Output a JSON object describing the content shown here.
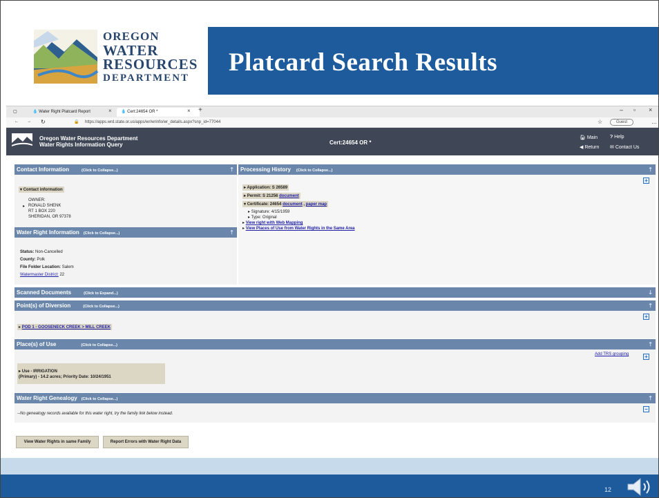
{
  "slide": {
    "title": "Platcard Search Results",
    "logo": {
      "line1": "OREGON",
      "line2": "WATER",
      "line3": "RESOURCES",
      "line4": "DEPARTMENT"
    },
    "page_number": "12",
    "colors": {
      "band": "#1d5b9d",
      "panel_header": "#6a87ab",
      "app_header": "#3f4756"
    }
  },
  "browser": {
    "tab1": "Water Right Platcard Report",
    "tab2": "Cert:24654 OR *",
    "new_tab": "+",
    "url": "https://apps.wrd.state.or.us/apps/wr/wrinfo/wr_details.aspx?snp_id=77044",
    "profile": "Guest",
    "icons": [
      "back-icon",
      "forward-icon",
      "refresh-icon",
      "lock-icon",
      "star-icon",
      "menu-icon"
    ]
  },
  "app": {
    "title_line1": "Oregon Water Resources Department",
    "title_line2": "Water Rights Information Query",
    "cert_title": "Cert:24654 OR *",
    "nav": {
      "main": "Main",
      "help": "Help",
      "return": "Return",
      "contact": "Contact Us"
    }
  },
  "contact": {
    "header": "Contact Information",
    "toggle": "(Click to Collapse...)",
    "subheader": "Contact information",
    "owner_label": "OWNER:",
    "name": "RONALD SHENK",
    "address1": "RT 1 BOX 220",
    "address2": "SHERIDAN, OR 97378"
  },
  "water_right": {
    "header": "Water Right Information",
    "toggle": "(Click to Collapse...)",
    "status_label": "Status:",
    "status": "Non-Cancelled",
    "county_label": "County:",
    "county": "Polk",
    "folder_label": "File Folder Location:",
    "folder": "Salem",
    "watermaster_label": "Watermaster District:",
    "watermaster": "22"
  },
  "processing": {
    "header": "Processing History",
    "toggle": "(Click to Collapse...)",
    "application": "Application: S 26589",
    "permit": "Permit: S 21256",
    "permit_doc": "document",
    "certificate": "Certificate: 24654",
    "cert_doc": "document",
    "cert_sep": ",",
    "cert_map": "paper map",
    "signature": "Signature: 4/15/1959",
    "type": "Type: Original",
    "web_mapping": "View right with Web Mapping",
    "places_same_area": "View Places of Use from Water Rights in the Same Area"
  },
  "scanned": {
    "header": "Scanned Documents",
    "toggle": "(Click to Expand...)"
  },
  "pod": {
    "header": "Point(s) of Diversion",
    "toggle": "(Click to Collapse...)",
    "item": "POD 1 - GOOSENECK CREEK > MILL CREEK"
  },
  "pou": {
    "header": "Place(s) of Use",
    "toggle": "(Click to Collapse...)",
    "trs_link": "Add TRS grouping",
    "use_line1": "Use - IRRIGATION",
    "use_line2": "(Primary) - 14.2 acres; Priority Date: 10/24/1951"
  },
  "genealogy": {
    "header": "Water Right Genealogy",
    "toggle": "(Click to Collapse...)",
    "message": "--No genealogy records available for this water right, try the family link below instead."
  },
  "buttons": {
    "family": "View Water Rights in same Family",
    "report_errors": "Report Errors with Water Right Data"
  }
}
